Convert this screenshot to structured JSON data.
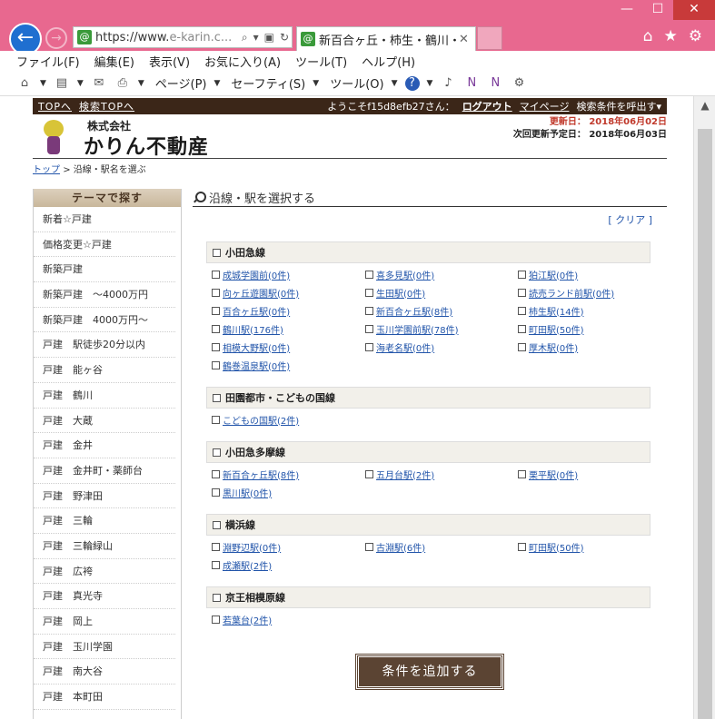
{
  "browser": {
    "url_prefix": "https://www.",
    "url_domain": "e-karin.c...",
    "tab_title": "新百合ヶ丘・柿生・鶴川・玉...",
    "menu": [
      "ファイル(F)",
      "編集(E)",
      "表示(V)",
      "お気に入り(A)",
      "ツール(T)",
      "ヘルプ(H)"
    ],
    "cmd": {
      "page": "ページ(P)",
      "safety": "セーフティ(S)",
      "tools": "ツール(O)"
    },
    "win": {
      "minimize": "—",
      "maximize": "☐",
      "close": "✕"
    },
    "icons": {
      "back": "←",
      "forward": "→",
      "home": "⌂",
      "star": "★",
      "gear": "⚙",
      "search": "🔍",
      "dropdown": "▾",
      "lock": "🔒",
      "refresh": "↻",
      "close": "✕"
    }
  },
  "site": {
    "top_links": [
      "TOPへ",
      "検索TOPへ"
    ],
    "welcome": "ようこそf15d8efb27さん：",
    "logout": "ログアウト",
    "mypage": "マイページ",
    "recall": "検索条件を呼出す▾",
    "company_prefix": "株式会社",
    "company_name": "かりん不動産",
    "updated": "更新日： 2018年06月02日",
    "next_update": "次回更新予定日： 2018年06月03日",
    "breadcrumb_home": "トップ",
    "breadcrumb_current": "> 沿線・駅名を選ぶ"
  },
  "sidebar": {
    "title": "テーマで探す",
    "items": [
      "新着☆戸建",
      "価格変更☆戸建",
      "新築戸建",
      "新築戸建　～4000万円",
      "新築戸建　4000万円～",
      "戸建　駅徒歩20分以内",
      "戸建　能ヶ谷",
      "戸建　鶴川",
      "戸建　大蔵",
      "戸建　金井",
      "戸建　金井町・薬師台",
      "戸建　野津田",
      "戸建　三輪",
      "戸建　三輪緑山",
      "戸建　広袴",
      "戸建　真光寺",
      "戸建　岡上",
      "戸建　玉川学園",
      "戸建　南大谷",
      "戸建　本町田"
    ]
  },
  "main": {
    "title": "沿線・駅を選択する",
    "clear": "[ クリア ]",
    "add_button": "条件を追加する",
    "lines": [
      {
        "name": "小田急線",
        "stations": [
          "成城学園前(0件)",
          "喜多見駅(0件)",
          "狛江駅(0件)",
          "向ヶ丘遊園駅(0件)",
          "生田駅(0件)",
          "読売ランド前駅(0件)",
          "百合ヶ丘駅(0件)",
          "新百合ヶ丘駅(8件)",
          "柿生駅(14件)",
          "鶴川駅(176件)",
          "玉川学園前駅(78件)",
          "町田駅(50件)",
          "相模大野駅(0件)",
          "海老名駅(0件)",
          "厚木駅(0件)",
          "鶴巻温泉駅(0件)"
        ]
      },
      {
        "name": "田園都市・こどもの国線",
        "stations": [
          "こどもの国駅(2件)"
        ]
      },
      {
        "name": "小田急多摩線",
        "stations": [
          "新百合ヶ丘駅(8件)",
          "五月台駅(2件)",
          "栗平駅(0件)",
          "黒川駅(0件)"
        ]
      },
      {
        "name": "横浜線",
        "stations": [
          "淵野辺駅(0件)",
          "古淵駅(6件)",
          "町田駅(50件)",
          "成瀬駅(2件)"
        ]
      },
      {
        "name": "京王相模原線",
        "stations": [
          "若葉台(2件)"
        ]
      }
    ]
  }
}
